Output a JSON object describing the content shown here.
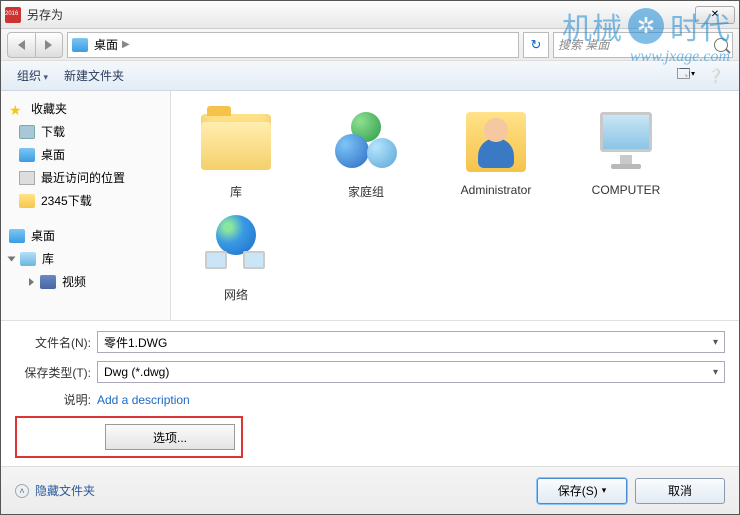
{
  "window": {
    "title": "另存为"
  },
  "nav": {
    "location": "桌面",
    "search_placeholder": "搜索 桌面"
  },
  "toolbar": {
    "organize": "组织",
    "new_folder": "新建文件夹"
  },
  "sidebar": {
    "favorites": {
      "label": "收藏夹",
      "items": [
        {
          "label": "下载",
          "cls": "s-mon"
        },
        {
          "label": "桌面",
          "cls": "s-blue"
        },
        {
          "label": "最近访问的位置",
          "cls": "s-recent"
        },
        {
          "label": "2345下载",
          "cls": "s-folder"
        }
      ]
    },
    "desktop": {
      "label": "桌面",
      "items": [
        {
          "label": "库",
          "cls": "s-lib",
          "children": [
            {
              "label": "视频",
              "cls": "s-film"
            }
          ]
        }
      ]
    }
  },
  "content": {
    "items": [
      {
        "label": "库",
        "icon": "library"
      },
      {
        "label": "家庭组",
        "icon": "homegroup"
      },
      {
        "label": "Administrator",
        "icon": "user"
      },
      {
        "label": "COMPUTER",
        "icon": "computer"
      },
      {
        "label": "网络",
        "icon": "network"
      }
    ]
  },
  "form": {
    "filename_label": "文件名(N):",
    "filename_value": "零件1.DWG",
    "type_label": "保存类型(T):",
    "type_value": "Dwg (*.dwg)",
    "desc_label": "说明:",
    "desc_value": "Add a description",
    "options_label": "选项..."
  },
  "footer": {
    "hide_label": "隐藏文件夹",
    "save_label": "保存(S)",
    "cancel_label": "取消"
  },
  "watermark": {
    "left": "机械",
    "right": "时代",
    "url": "www.jxage.com"
  }
}
